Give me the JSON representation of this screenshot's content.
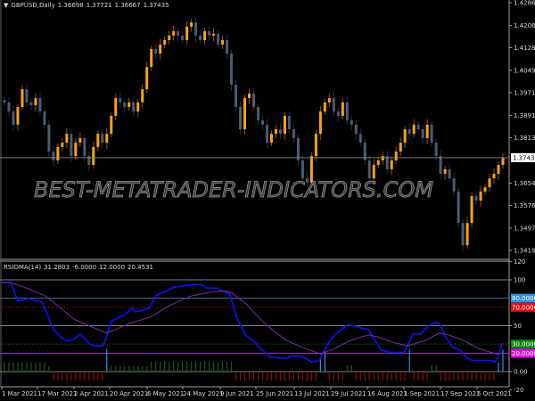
{
  "main_pane": {
    "symbol_label": "GBPUSD,Daily",
    "ohlc": [
      "1.36698",
      "1.37721",
      "1.36667",
      "1.37435"
    ],
    "current_price": "1.37435",
    "watermark": "BEST-METATRADER-INDICATORS.COM",
    "colors": {
      "bull": "#f7a21b",
      "bear": "#4b5b70",
      "grid_line": "#8c8c8c"
    }
  },
  "indicator_pane": {
    "label": "RSIOMA(14)",
    "values": [
      "31.2803",
      "-6.0000",
      "12.0000",
      "20.4531"
    ],
    "levels": [
      {
        "value": "80.0000",
        "color": "#2f8fd8"
      },
      {
        "value": "70.0000",
        "color": "#e01010"
      },
      {
        "value": "30.0000",
        "color": "#108010"
      },
      {
        "value": "20.0000",
        "color": "#e010e0"
      }
    ]
  },
  "chart_data": [
    {
      "type": "candlestick",
      "title": "GBPUSD,Daily",
      "ylim": [
        1.3419,
        1.4286
      ],
      "y_ticks": [
        "1.42860",
        "1.42065",
        "1.41285",
        "1.40490",
        "1.39710",
        "1.38915",
        "1.38135",
        "1.36545",
        "1.35765",
        "1.34970",
        "1.34190"
      ],
      "x_ticks": [
        "1 Mar 2021",
        "17 Mar 2021",
        "2 Apr 2021",
        "20 Apr 2021",
        "6 May 2021",
        "24 May 2021",
        "9 Jun 2021",
        "25 Jun 2021",
        "13 Jul 2021",
        "29 Jul 2021",
        "16 Aug 2021",
        "1 Sep 2021",
        "17 Sep 2021",
        "5 Oct 2021"
      ],
      "closes": [
        1.3937,
        1.3905,
        1.3859,
        1.3921,
        1.3983,
        1.3937,
        1.3927,
        1.3952,
        1.3905,
        1.3859,
        1.3765,
        1.3734,
        1.3781,
        1.3796,
        1.3827,
        1.3749,
        1.3796,
        1.3812,
        1.3749,
        1.3718,
        1.3781,
        1.3827,
        1.3796,
        1.3827,
        1.389,
        1.3952,
        1.3937,
        1.3921,
        1.3937,
        1.3905,
        1.3937,
        1.3983,
        1.4061,
        1.4124,
        1.4108,
        1.4139,
        1.4155,
        1.4171,
        1.4186,
        1.4171,
        1.4155,
        1.4202,
        1.4217,
        1.4171,
        1.4155,
        1.4186,
        1.4171,
        1.4177,
        1.4139,
        1.4155,
        1.4108,
        1.3999,
        1.3921,
        1.3843,
        1.3952,
        1.3968,
        1.3921,
        1.3874,
        1.3859,
        1.3796,
        1.3827,
        1.3843,
        1.3827,
        1.389,
        1.3843,
        1.3812,
        1.3734,
        1.3671,
        1.3656,
        1.3749,
        1.3827,
        1.3905,
        1.3937,
        1.3952,
        1.3905,
        1.389,
        1.3937,
        1.3874,
        1.3859,
        1.3827,
        1.3796,
        1.3734,
        1.3671,
        1.3718,
        1.3734,
        1.3749,
        1.3703,
        1.3734,
        1.3765,
        1.3796,
        1.3843,
        1.3827,
        1.3859,
        1.3843,
        1.3812,
        1.3859,
        1.3796,
        1.3749,
        1.3687,
        1.3703,
        1.3671,
        1.3625,
        1.3515,
        1.3437,
        1.3515,
        1.3609,
        1.3593,
        1.3625,
        1.364,
        1.3671,
        1.3687,
        1.3718,
        1.3743
      ]
    },
    {
      "type": "line",
      "title": "RSIOMA(14)",
      "ylim": [
        -20,
        120
      ],
      "y_ticks": [
        "120",
        "100",
        "50",
        "0.00",
        "-20"
      ],
      "levels": [
        100,
        80,
        70,
        50,
        30,
        20,
        0
      ],
      "series": [
        {
          "color": "#1010ff",
          "points": [
            [
              2,
              97
            ],
            [
              12,
              97
            ],
            [
              20,
              77
            ],
            [
              27,
              78
            ],
            [
              32,
              80
            ],
            [
              40,
              77
            ],
            [
              47,
              76
            ],
            [
              52,
              65
            ],
            [
              60,
              46
            ],
            [
              70,
              36
            ],
            [
              77,
              33
            ],
            [
              85,
              37
            ],
            [
              90,
              41
            ],
            [
              95,
              36
            ],
            [
              100,
              30
            ],
            [
              107,
              28
            ],
            [
              115,
              28
            ],
            [
              118,
              34
            ],
            [
              125,
              55
            ],
            [
              133,
              59
            ],
            [
              140,
              62
            ],
            [
              148,
              69
            ],
            [
              152,
              65
            ],
            [
              160,
              67
            ],
            [
              167,
              69
            ],
            [
              175,
              83
            ],
            [
              185,
              87
            ],
            [
              195,
              92
            ],
            [
              210,
              94
            ],
            [
              225,
              95
            ],
            [
              232,
              91
            ],
            [
              243,
              91
            ],
            [
              258,
              84
            ],
            [
              265,
              60
            ],
            [
              275,
              40
            ],
            [
              285,
              33
            ],
            [
              290,
              27
            ],
            [
              303,
              16
            ],
            [
              320,
              14
            ],
            [
              327,
              17
            ],
            [
              340,
              16
            ],
            [
              350,
              10
            ],
            [
              358,
              12
            ],
            [
              370,
              34
            ],
            [
              380,
              44
            ],
            [
              390,
              51
            ],
            [
              400,
              49
            ],
            [
              407,
              47
            ],
            [
              413,
              46
            ],
            [
              427,
              24
            ],
            [
              437,
              21
            ],
            [
              453,
              21
            ],
            [
              457,
              28
            ],
            [
              463,
              41
            ],
            [
              472,
              41
            ],
            [
              482,
              51
            ],
            [
              489,
              54
            ],
            [
              493,
              52
            ],
            [
              500,
              38
            ],
            [
              507,
              27
            ],
            [
              517,
              23
            ],
            [
              523,
              15
            ],
            [
              530,
              12
            ],
            [
              550,
              12
            ],
            [
              555,
              11
            ],
            [
              560,
              18
            ],
            [
              563,
              31
            ]
          ]
        },
        {
          "color": "#7a2fa0",
          "points": [
            [
              2,
              97
            ],
            [
              12,
              97
            ],
            [
              27,
              92
            ],
            [
              50,
              83
            ],
            [
              67,
              70
            ],
            [
              83,
              57
            ],
            [
              100,
              50
            ],
            [
              120,
              42
            ],
            [
              147,
              53
            ],
            [
              170,
              60
            ],
            [
              190,
              72
            ],
            [
              213,
              82
            ],
            [
              233,
              86
            ],
            [
              250,
              88
            ],
            [
              260,
              86
            ],
            [
              277,
              73
            ],
            [
              290,
              59
            ],
            [
              307,
              44
            ],
            [
              323,
              33
            ],
            [
              340,
              26
            ],
            [
              360,
              19
            ],
            [
              377,
              26
            ],
            [
              393,
              34
            ],
            [
              413,
              40
            ],
            [
              423,
              38
            ],
            [
              440,
              32
            ],
            [
              457,
              28
            ],
            [
              477,
              34
            ],
            [
              493,
              42
            ],
            [
              503,
              40
            ],
            [
              520,
              34
            ],
            [
              537,
              25
            ],
            [
              557,
              19
            ],
            [
              563,
              20
            ]
          ]
        }
      ],
      "histogram": [
        10,
        10,
        10,
        10,
        10,
        10,
        10,
        10,
        10,
        10,
        6,
        -10,
        -10,
        -10,
        -10,
        -10,
        -10,
        -10,
        -10,
        -10,
        -10,
        -10,
        -10,
        25,
        6,
        6,
        6,
        6,
        6,
        6,
        6,
        6,
        6,
        11,
        11,
        11,
        11,
        11,
        11,
        11,
        11,
        11,
        11,
        11,
        11,
        11,
        11,
        11,
        11,
        11,
        11,
        11,
        -10,
        -10,
        -10,
        -10,
        -10,
        -10,
        -10,
        -10,
        -10,
        -10,
        -10,
        -10,
        -10,
        -10,
        -10,
        -10,
        -10,
        -10,
        -10,
        14,
        24,
        -10,
        -10,
        -10,
        -10,
        7,
        7,
        -10,
        -10,
        -10,
        -10,
        -10,
        -10,
        -10,
        -10,
        -10,
        -10,
        -10,
        -10,
        24,
        -10,
        -10,
        -10,
        -10,
        7,
        7,
        -10,
        -10,
        -10,
        -10,
        -10,
        -10,
        -10,
        -10,
        -10,
        -10,
        -10,
        -10,
        -10,
        10,
        24
      ]
    }
  ]
}
